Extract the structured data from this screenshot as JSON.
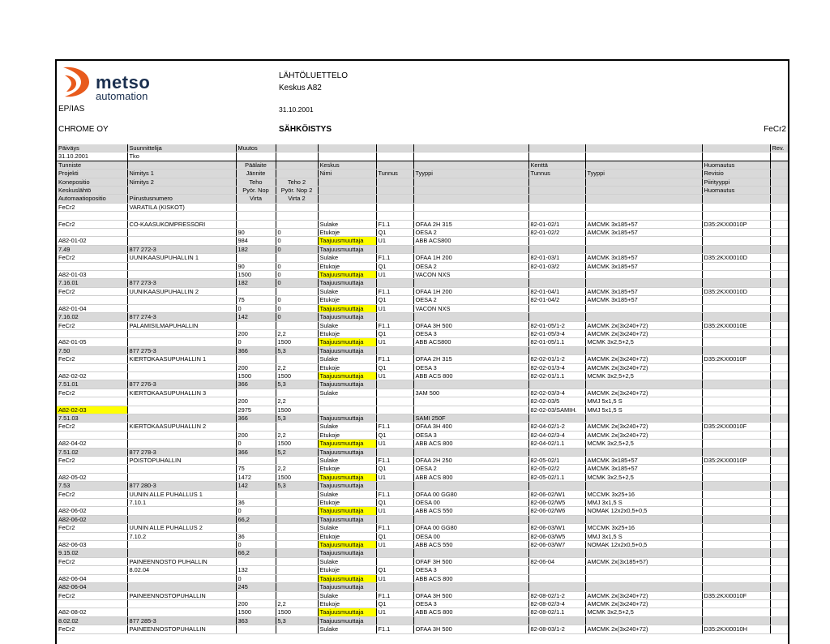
{
  "header": {
    "brand": "metso",
    "brand_sub": "automation",
    "dept": "EP/IAS",
    "title": "LÄHTÖLUETTELO",
    "subtitle": "Keskus A82",
    "date": "31.10.2001",
    "company": "CHROME OY",
    "section": "SÄHKÖISTYS",
    "code": "FeCr2"
  },
  "meta": {
    "labels": [
      "Päiväys",
      "Suunnittelija",
      "Muutos",
      "Rev."
    ],
    "values": [
      "31.10.2001",
      "Tko",
      "",
      ""
    ]
  },
  "header_rows": [
    [
      "Tunniste",
      "",
      "Päälaite",
      "",
      "Keskus",
      "",
      "",
      "Kenttä",
      "",
      "Huomautus",
      ""
    ],
    [
      "Projekti",
      "Nimitys 1",
      "Jännite",
      "",
      "Nimi",
      "Tunnus",
      "Tyyppi",
      "Tunnus",
      "Tyyppi",
      "Revisio",
      ""
    ],
    [
      "Konepositio",
      "Nimitys 2",
      "Teho",
      "Teho 2",
      "",
      "",
      "",
      "",
      "",
      "Piirityyppi",
      ""
    ],
    [
      "Keskuslähtö",
      "",
      "Pyör. Nop",
      "Pyör. Nop 2",
      "",
      "",
      "",
      "",
      "",
      "Huomautus",
      ""
    ],
    [
      "Automaatiopositio",
      "Piirustusnumero",
      "Virta",
      "Virta 2",
      "",
      "",
      "",
      "",
      "",
      "",
      ""
    ]
  ],
  "rows": [
    [
      "FeCr2",
      "VARATILA (KISKOT)",
      "",
      "",
      "",
      "",
      "",
      "",
      "",
      "",
      ""
    ],
    [
      "",
      "",
      "",
      "",
      "",
      "",
      "",
      "",
      "",
      "",
      ""
    ],
    [
      "FeCr2",
      "CO-KAASUKOMPRESSORI",
      "",
      "",
      "Sulake",
      "F1.1",
      "OFAA 2H 315",
      "82-01-02/1",
      "AMCMK 3x185+57",
      "D35:2KXI0010P",
      ""
    ],
    [
      "",
      "",
      "90",
      "0",
      "Etukoje",
      "Q1",
      "OESA 2",
      "82-01-02/2",
      "AMCMK 3x185+57",
      "",
      ""
    ],
    [
      "A82-01-02",
      "",
      "984",
      "0",
      "Taajuusmuuttaja",
      "U1",
      "ABB ACS800",
      "",
      "",
      "",
      ""
    ],
    [
      "7.49",
      "877 272-3",
      "182",
      "0",
      "Taajuusmuuttaja",
      "",
      "",
      "",
      "",
      "",
      ""
    ],
    [
      "FeCr2",
      "UUNIKAASUPUHALLIN 1",
      "",
      "",
      "Sulake",
      "F1.1",
      "OFAA 1H 200",
      "82-01-03/1",
      "AMCMK 3x185+57",
      "D35:2KXI0010D",
      ""
    ],
    [
      "",
      "",
      "90",
      "0",
      "Etukoje",
      "Q1",
      "OESA 2",
      "82-01-03/2",
      "AMCMK 3x185+57",
      "",
      ""
    ],
    [
      "A82-01-03",
      "",
      "1500",
      "0",
      "Taajuusmuuttaja",
      "U1",
      "VACON NXS",
      "",
      "",
      "",
      ""
    ],
    [
      "7.16.01",
      "877 273-3",
      "182",
      "0",
      "Taajuusmuuttaja",
      "",
      "",
      "",
      "",
      "",
      ""
    ],
    [
      "FeCr2",
      "UUNIKAASUPUHALLIN 2",
      "",
      "",
      "Sulake",
      "F1.1",
      "OFAA 1H 200",
      "82-01-04/1",
      "AMCMK 3x185+57",
      "D35:2KXI0010D",
      ""
    ],
    [
      "",
      "",
      "75",
      "0",
      "Etukoje",
      "Q1",
      "OESA 2",
      "82-01-04/2",
      "AMCMK 3x185+57",
      "",
      ""
    ],
    [
      "A82-01-04",
      "",
      "0",
      "0",
      "Taajuusmuuttaja",
      "U1",
      "VACON NXS",
      "",
      "",
      "",
      ""
    ],
    [
      "7.16.02",
      "877 274-3",
      "142",
      "0",
      "Taajuusmuuttaja",
      "",
      "",
      "",
      "",
      "",
      ""
    ],
    [
      "FeCr2",
      "PALAMISILMAPUHALLIN",
      "",
      "",
      "Sulake",
      "F1.1",
      "OFAA 3H 500",
      "82-01-05/1-2",
      "AMCMK 2x(3x240+72)",
      "D35:2KXI0010E",
      ""
    ],
    [
      "",
      "",
      "200",
      "2,2",
      "Etukoje",
      "Q1",
      "OESA 3",
      "82-01-05/3-4",
      "AMCMK 2x(3x240+72)",
      "",
      ""
    ],
    [
      "A82-01-05",
      "",
      "0",
      "1500",
      "Taajuusmuuttaja",
      "U1",
      "ABB ACS800",
      "82-01-05/1.1",
      "MCMK 3x2,5+2,5",
      "",
      ""
    ],
    [
      "7.50",
      "877 275-3",
      "366",
      "5,3",
      "Taajuusmuuttaja",
      "",
      "",
      "",
      "",
      "",
      ""
    ],
    [
      "FeCr2",
      "KIERTOKAASUPUHALLIN 1",
      "",
      "",
      "Sulake",
      "F1.1",
      "OFAA 2H 315",
      "82-02-01/1-2",
      "AMCMK 2x(3x240+72)",
      "D35:2KXI0010F",
      ""
    ],
    [
      "",
      "",
      "200",
      "2,2",
      "Etukoje",
      "Q1",
      "OESA 3",
      "82-02-01/3-4",
      "AMCMK 2x(3x240+72)",
      "",
      ""
    ],
    [
      "A82-02-02",
      "",
      "1500",
      "1500",
      "Taajuusmuuttaja",
      "U1",
      "ABB ACS 800",
      "82-02-01/1.1",
      "MCMK 3x2,5+2,5",
      "",
      ""
    ],
    [
      "7.51.01",
      "877 276-3",
      "366",
      "5,3",
      "Taajuusmuuttaja",
      "",
      "",
      "",
      "",
      "",
      ""
    ],
    [
      "FeCr2",
      "KIERTOKAASUPUHALLIN 3",
      "",
      "",
      "Sulake",
      "",
      "3AM 500",
      "82-02-03/3-4",
      "AMCMK 2x(3x240+72)",
      "",
      ""
    ],
    [
      "",
      "",
      "200",
      "2,2",
      "",
      "",
      "",
      "82-02-03/5",
      "MMJ 5x1,5 S",
      "",
      ""
    ],
    [
      "A82-02-03",
      "",
      "2975",
      "1500",
      "",
      "",
      "",
      "82-02-03/SAMIH.",
      "MMJ 5x1,5 S",
      "",
      ""
    ],
    [
      "7.51.03",
      "",
      "366",
      "5,3",
      "Taajuusmuuttaja",
      "",
      "SAMI 250F",
      "",
      "",
      "",
      ""
    ],
    [
      "FeCr2",
      "KIERTOKAASUPUHALLIN 2",
      "",
      "",
      "Sulake",
      "F1.1",
      "OFAA 3H 400",
      "82-04-02/1-2",
      "AMCMK 2x(3x240+72)",
      "D35:2KXI0010F",
      ""
    ],
    [
      "",
      "",
      "200",
      "2,2",
      "Etukoje",
      "Q1",
      "OESA 3",
      "82-04-02/3-4",
      "AMCMK 2x(3x240+72)",
      "",
      ""
    ],
    [
      "A82-04-02",
      "",
      "0",
      "1500",
      "Taajuusmuuttaja",
      "U1",
      "ABB ACS 800",
      "82-04-02/1.1",
      "MCMK 3x2,5+2,5",
      "",
      ""
    ],
    [
      "7.51.02",
      "877 278-3",
      "366",
      "5,2",
      "Taajuusmuuttaja",
      "",
      "",
      "",
      "",
      "",
      ""
    ],
    [
      "FeCr2",
      "POISTOPUHALLIN",
      "",
      "",
      "Sulake",
      "F1.1",
      "OFAA 2H 250",
      "82-05-02/1",
      "AMCMK 3x185+57",
      "D35:2KXI0010P",
      ""
    ],
    [
      "",
      "",
      "75",
      "2,2",
      "Etukoje",
      "Q1",
      "OESA 2",
      "82-05-02/2",
      "AMCMK 3x185+57",
      "",
      ""
    ],
    [
      "A82-05-02",
      "",
      "1472",
      "1500",
      "Taajuusmuuttaja",
      "U1",
      "ABB ACS 800",
      "82-05-02/1.1",
      "MCMK 3x2,5+2,5",
      "",
      ""
    ],
    [
      "7.53",
      "877 280-3",
      "142",
      "5,3",
      "Taajuusmuuttaja",
      "",
      "",
      "",
      "",
      "",
      ""
    ],
    [
      "FeCr2",
      "UUNIN ALLE PUHALLUS 1",
      "",
      "",
      "Sulake",
      "F1.1",
      "OFAA 00 GG80",
      "82-06-02/W1",
      "MCCMK 3x25+16",
      "",
      ""
    ],
    [
      "",
      "7.10.1",
      "36",
      "",
      "Etukoje",
      "Q1",
      "OESA 00",
      "82-06-02/W5",
      "MMJ 3x1,5 S",
      "",
      ""
    ],
    [
      "A82-06-02",
      "",
      "0",
      "",
      "Taajuusmuuttaja",
      "U1",
      "ABB ACS 550",
      "82-06-02/W6",
      "NOMAK 12x2x0,5+0,5",
      "",
      ""
    ],
    [
      "A82-06-02",
      "",
      "66,2",
      "",
      "Taajuusmuuttaja",
      "",
      "",
      "",
      "",
      "",
      ""
    ],
    [
      "FeCr2",
      "UUNIN ALLE PUHALLUS 2",
      "",
      "",
      "Sulake",
      "F1.1",
      "OFAA 00 GG80",
      "82-06-03/W1",
      "MCCMK 3x25+16",
      "",
      ""
    ],
    [
      "",
      "7.10.2",
      "36",
      "",
      "Etukoje",
      "Q1",
      "OESA 00",
      "82-06-03/W5",
      "MMJ 3x1,5 S",
      "",
      ""
    ],
    [
      "A82-06-03",
      "",
      "0",
      "",
      "Taajuusmuuttaja",
      "U1",
      "ABB ACS 550",
      "82-06-03/W7",
      "NOMAK 12x2x0,5+0,5",
      "",
      ""
    ],
    [
      "9.15.02",
      "",
      "66,2",
      "",
      "Taajuusmuuttaja",
      "",
      "",
      "",
      "",
      "",
      ""
    ],
    [
      "FeCr2",
      "PAINEENNOSTO PUHALLIN",
      "",
      "",
      "Sulake",
      "",
      "OFAF 3H 500",
      "82-06-04",
      "AMCMK 2x(3x185+57)",
      "",
      ""
    ],
    [
      "",
      "8.02.04",
      "132",
      "",
      "Etukoje",
      "Q1",
      "OESA 3",
      "",
      "",
      "",
      ""
    ],
    [
      "A82-06-04",
      "",
      "0",
      "",
      "Taajuusmuuttaja",
      "U1",
      "ABB ACS 800",
      "",
      "",
      "",
      ""
    ],
    [
      "A82-06-04",
      "",
      "245",
      "",
      "Taajuusmuuttaja",
      "",
      "",
      "",
      "",
      "",
      ""
    ],
    [
      "FeCr2",
      "PAINEENNOSTOPUHALLIN",
      "",
      "",
      "Sulake",
      "F1.1",
      "OFAA 3H 500",
      "82-08-02/1-2",
      "AMCMK 2x(3x240+72)",
      "D35:2KXI0010F",
      ""
    ],
    [
      "",
      "",
      "200",
      "2,2",
      "Etukoje",
      "Q1",
      "OESA 3",
      "82-08-02/3-4",
      "AMCMK 2x(3x240+72)",
      "",
      ""
    ],
    [
      "A82-08-02",
      "",
      "1500",
      "1500",
      "Taajuusmuuttaja",
      "U1",
      "ABB ACS 800",
      "82-08-02/1.1",
      "MCMK 3x2,5+2,5",
      "",
      ""
    ],
    [
      "8.02.02",
      "877 285-3",
      "363",
      "5,3",
      "Taajuusmuuttaja",
      "",
      "",
      "",
      "",
      "",
      ""
    ],
    [
      "FeCr2",
      "PAINEENNOSTOPUHALLIN",
      "",
      "",
      "Sulake",
      "F1.1",
      "OFAA 3H 500",
      "82-08-03/1-2",
      "AMCMK 2x(3x240+72)",
      "D35:2KXI0010H",
      ""
    ]
  ],
  "highlight_value": "Taajuusmuuttaja",
  "highlight_cells": [
    "A82-02-03"
  ]
}
